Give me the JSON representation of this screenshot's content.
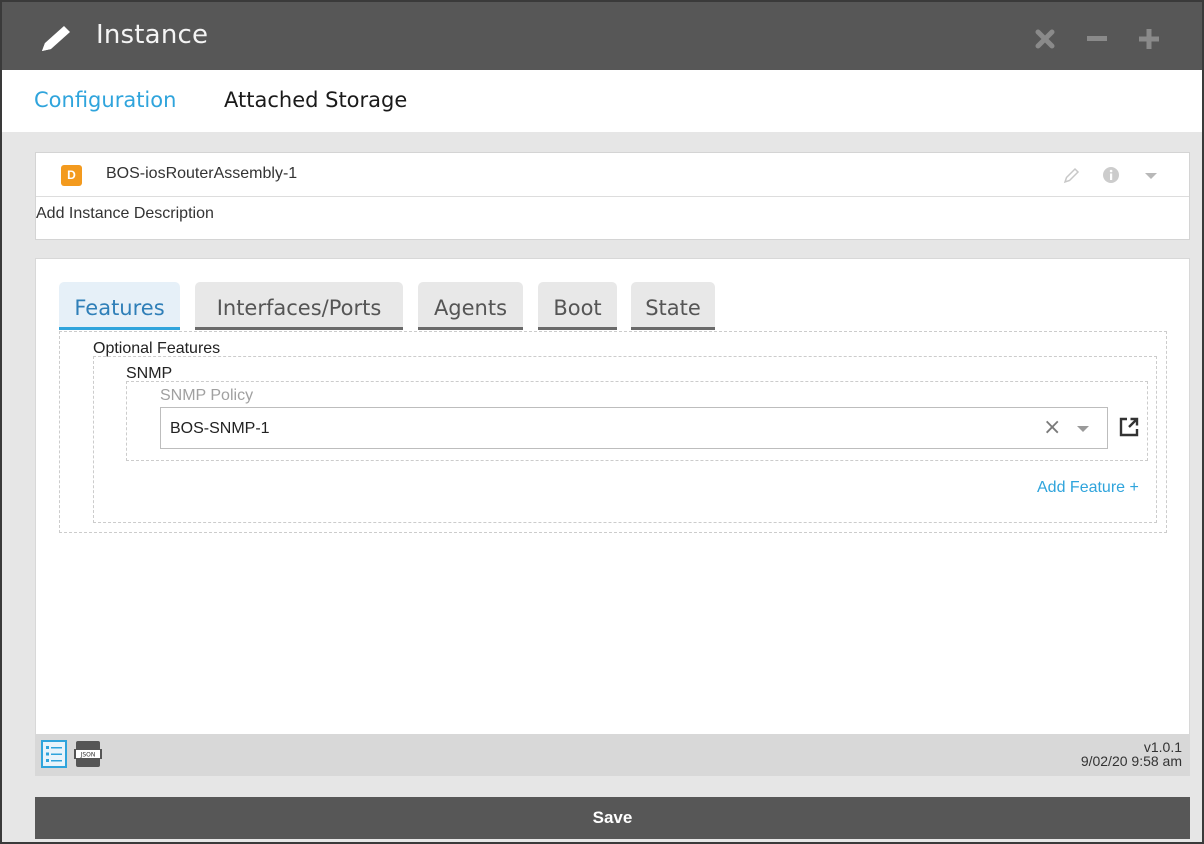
{
  "window": {
    "title": "Instance",
    "title_icon": "pencil-icon",
    "controls": [
      "close-icon",
      "minimize-icon",
      "maximize-icon"
    ]
  },
  "top_tabs": [
    {
      "label": "Configuration",
      "active": true
    },
    {
      "label": "Attached Storage",
      "active": false
    }
  ],
  "instance": {
    "badge": "D",
    "name": "BOS-iosRouterAssembly-1",
    "description": "Add Instance Description",
    "header_icons": [
      "edit-icon",
      "info-icon",
      "caret-down-icon"
    ]
  },
  "feature_tabs": [
    {
      "label": "Features",
      "active": true
    },
    {
      "label": "Interfaces/Ports",
      "active": false
    },
    {
      "label": "Agents",
      "active": false
    },
    {
      "label": "Boot",
      "active": false
    },
    {
      "label": "State",
      "active": false
    }
  ],
  "features": {
    "section_label": "Optional Features",
    "snmp": {
      "label": "SNMP",
      "policy_label": "SNMP Policy",
      "policy_value": "BOS-SNMP-1",
      "clear_symbol": "×"
    },
    "add_feature_label": "Add Feature +"
  },
  "footer": {
    "view_icons": [
      "form-view-icon",
      "json-view-icon"
    ],
    "json_icon_text": "JSON",
    "version": "v1.0.1",
    "timestamp": "9/02/20 9:58 am"
  },
  "save_label": "Save",
  "colors": {
    "title_bar": "#575757",
    "accent": "#2fa4dc",
    "badge": "#f39a1e",
    "save_bar": "#575757"
  }
}
